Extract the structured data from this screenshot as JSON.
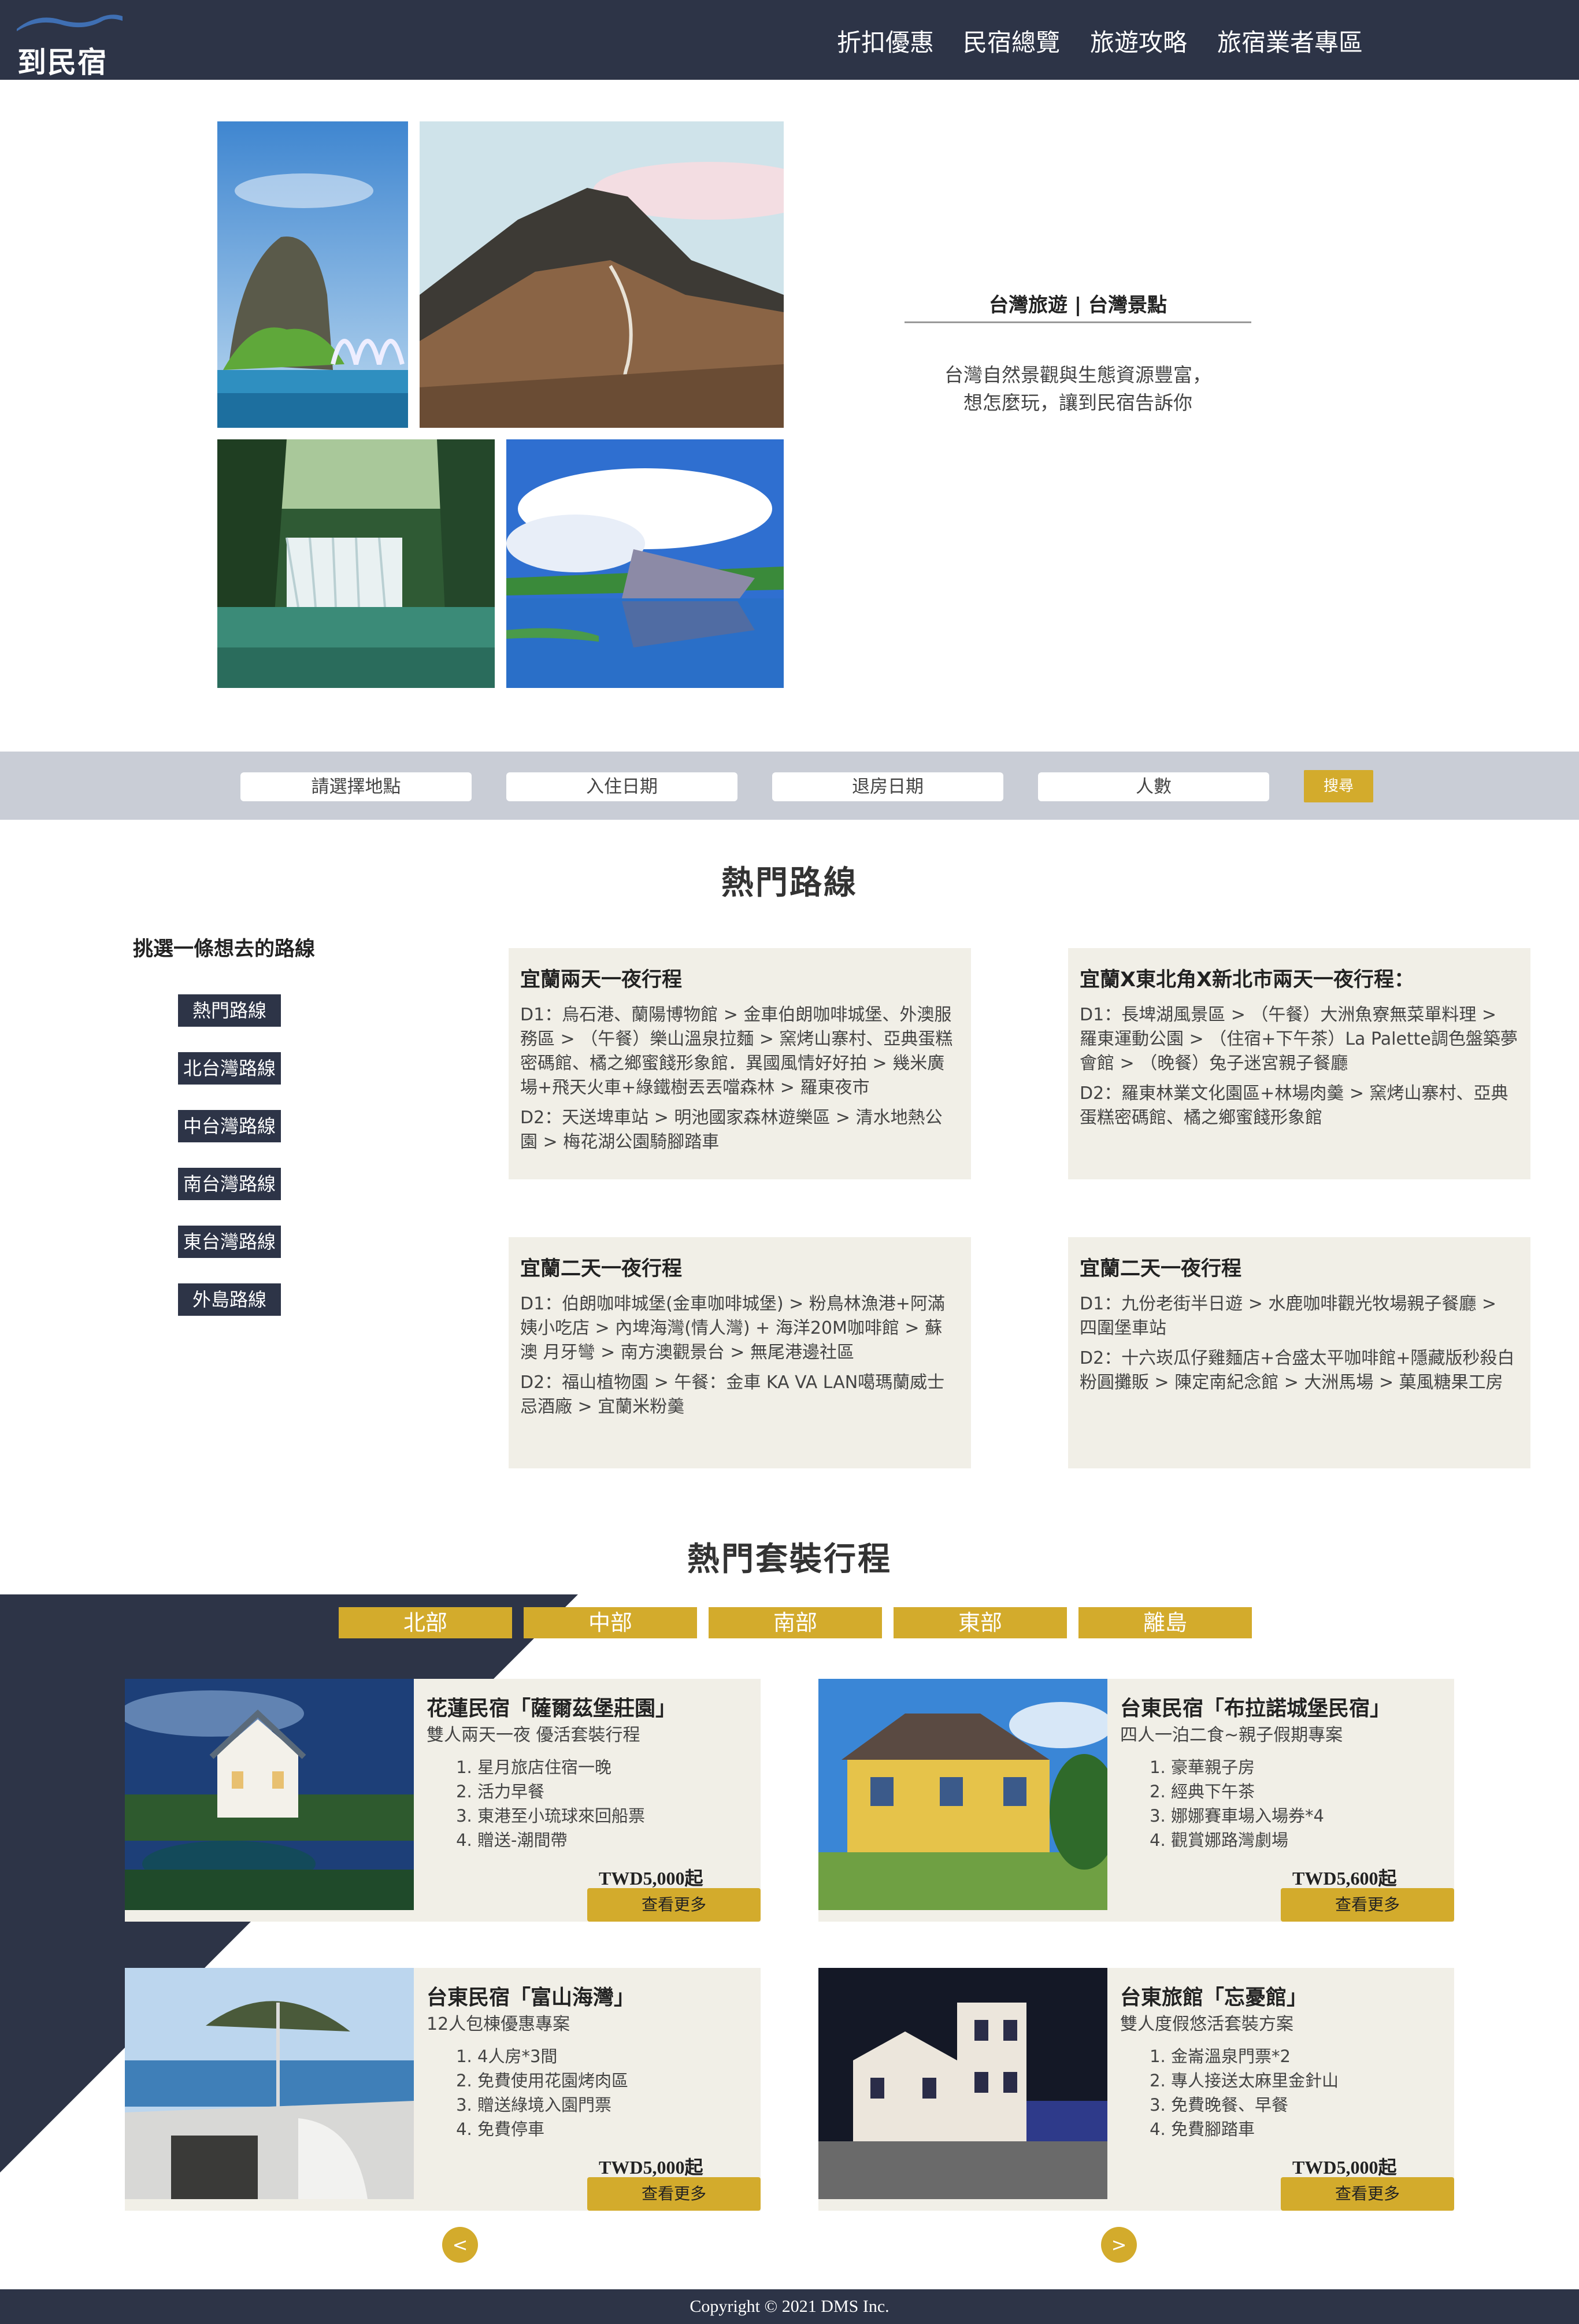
{
  "header": {
    "logo_text": "到民宿",
    "nav": [
      "折扣優惠",
      "民宿總覽",
      "旅遊攻略",
      "旅宿業者專區"
    ]
  },
  "hero": {
    "title": "台灣旅遊 | 台灣景點",
    "desc_line1": "台灣自然景觀與生態資源豐富，",
    "desc_line2": "想怎麼玩，讓到民宿告訴你"
  },
  "search": {
    "location": "請選擇地點",
    "checkin": "入住日期",
    "checkout": "退房日期",
    "guests": "人數",
    "button": "搜尋"
  },
  "routes": {
    "title": "熱門路線",
    "prompt": "挑選一條想去的路線",
    "buttons": [
      "熱門路線",
      "北台灣路線",
      "中台灣路線",
      "南台灣路線",
      "東台灣路線",
      "外島路線"
    ],
    "cards": [
      {
        "title": "宜蘭兩天一夜行程",
        "d1": "D1：烏石港、蘭陽博物館 > 金車伯朗咖啡城堡、外澳服務區 > （午餐）樂山溫泉拉麵 > 窯烤山寨村、亞典蛋糕密碼館、橘之鄉蜜餞形象館．異國風情好好拍 > 幾米廣場+飛天火車+綠鐵樹丟丟噹森林 > 羅東夜市",
        "d2": "D2：天送埤車站 > 明池國家森林遊樂區 > 清水地熱公園 > 梅花湖公園騎腳踏車"
      },
      {
        "title": "宜蘭X東北角X新北市兩天一夜行程：",
        "d1": "D1：長埤湖風景區 > （午餐）大洲魚寮無菜單料理 > 羅東運動公園 > （住宿+下午茶）La Palette調色盤築夢會館 > （晚餐）兔子迷宮親子餐廳",
        "d2": "D2：羅東林業文化園區+林場肉羹 > 窯烤山寨村、亞典蛋糕密碼館、橘之鄉蜜餞形象館"
      },
      {
        "title": "宜蘭二天一夜行程",
        "d1": "D1：伯朗咖啡城堡(金車咖啡城堡) > 粉鳥林漁港+阿滿姨小吃店 > 內埤海灣(情人灣) + 海洋20M咖啡館 > 蘇澳 月牙彎 > 南方澳觀景台 > 無尾港邊社區",
        "d2": "D2：福山植物園 > 午餐：金車 KA VA LAN噶瑪蘭威士忌酒廠 > 宜蘭米粉羹"
      },
      {
        "title": "宜蘭二天一夜行程",
        "d1": "D1：九份老街半日遊 > 水鹿咖啡觀光牧場親子餐廳 > 四圍堡車站",
        "d2": "D2：十六崁瓜仔雞麵店+合盛太平咖啡館+隱藏版秒殺白粉圓攤販 > 陳定南紀念館 > 大洲馬場 > 菓風糖果工房"
      }
    ]
  },
  "packages": {
    "title": "熱門套裝行程",
    "tabs": [
      "北部",
      "中部",
      "南部",
      "東部",
      "離島"
    ],
    "cards": [
      {
        "title": "花蓮民宿「薩爾茲堡莊園」",
        "subtitle": "雙人兩天一夜 優活套裝行程",
        "items": [
          "星月旅店住宿一晚",
          "活力早餐",
          "東港至小琉球來回船票",
          "贈送-潮間帶"
        ],
        "price": "TWD5,000起",
        "button": "查看更多"
      },
      {
        "title": "台東民宿「布拉諾城堡民宿」",
        "subtitle": "四人一泊二食~親子假期專案",
        "items": [
          "豪華親子房",
          "經典下午茶",
          "娜娜賽車場入場券*4",
          "觀賞娜路灣劇場"
        ],
        "price": "TWD5,600起",
        "button": "查看更多"
      },
      {
        "title": "台東民宿「富山海灣」",
        "subtitle": "12人包棟優惠專案",
        "items": [
          "4人房*3間",
          "免費使用花園烤肉區",
          "贈送綠境入園門票",
          "免費停車"
        ],
        "price": "TWD5,000起",
        "button": "查看更多"
      },
      {
        "title": "台東旅館「忘憂館」",
        "subtitle": "雙人度假悠活套裝方案",
        "items": [
          "金崙溫泉門票*2",
          "專人接送太麻里金針山",
          "免費晚餐、早餐",
          "免費腳踏車"
        ],
        "price": "TWD5,000起",
        "button": "查看更多"
      }
    ],
    "prev": "<",
    "next": ">"
  },
  "footer": {
    "copyright": "Copyright © 2021 DMS Inc."
  },
  "colors": {
    "navy": "#2d3447",
    "gold": "#d3ab2c",
    "card_bg": "#f1efe7",
    "search_bg": "#c9cdd6"
  }
}
